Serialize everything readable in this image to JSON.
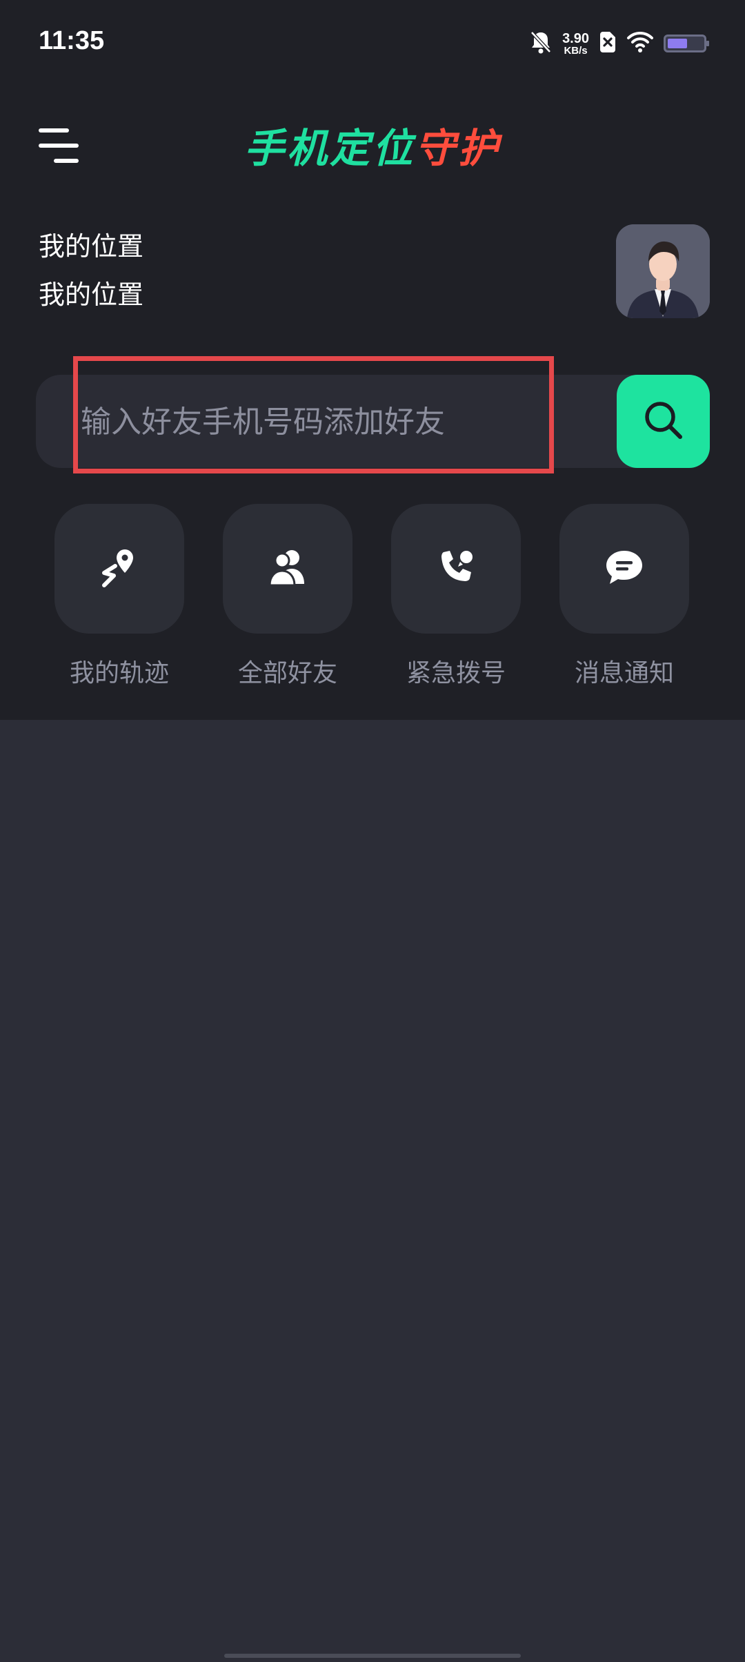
{
  "status_bar": {
    "time": "11:35",
    "net_speed_value": "3.90",
    "net_speed_unit": "KB/s",
    "icons": [
      "bell-off-icon",
      "sim-off-icon",
      "wifi-icon",
      "battery-icon"
    ]
  },
  "header": {
    "title_green": "手机定位",
    "title_red": "守护"
  },
  "location": {
    "line1": "我的位置",
    "line2": "我的位置"
  },
  "search": {
    "placeholder": "输入好友手机号码添加好友"
  },
  "actions": [
    {
      "label": "我的轨迹",
      "icon": "location-track-icon"
    },
    {
      "label": "全部好友",
      "icon": "friends-icon"
    },
    {
      "label": "紧急拨号",
      "icon": "phone-call-icon"
    },
    {
      "label": "消息通知",
      "icon": "message-icon"
    }
  ],
  "colors": {
    "accent_green": "#1ee39f",
    "title_red": "#ff4d3d",
    "highlight_red": "#e5484b",
    "panel_bg": "#1f2026",
    "body_bg": "#2c2d37"
  }
}
